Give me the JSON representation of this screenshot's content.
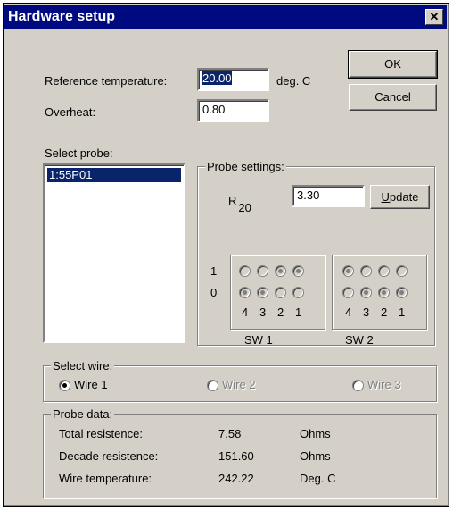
{
  "window": {
    "title": "Hardware setup",
    "close_glyph": "✕"
  },
  "reference": {
    "label": "Reference temperature:",
    "value": "20.00",
    "unit": "deg. C"
  },
  "overheat": {
    "label": "Overheat:",
    "value": "0.80"
  },
  "buttons": {
    "ok": "OK",
    "cancel": "Cancel",
    "update": "Update"
  },
  "probe": {
    "label": "Select probe:",
    "items": [
      "1:55P01"
    ],
    "selected": "1:55P01"
  },
  "settings": {
    "title": "Probe settings:",
    "r_label": "R",
    "r_sub": "20",
    "r_value": "3.30",
    "row_one": "1",
    "row_zero": "0",
    "sw1": {
      "label": "SW 1",
      "cols": [
        "4",
        "3",
        "2",
        "1"
      ],
      "row1": [
        false,
        false,
        true,
        true
      ],
      "row0": [
        true,
        true,
        false,
        false
      ]
    },
    "sw2": {
      "label": "SW 2",
      "cols": [
        "4",
        "3",
        "2",
        "1"
      ],
      "row1": [
        true,
        false,
        false,
        false
      ],
      "row0": [
        false,
        true,
        true,
        true
      ]
    }
  },
  "wire": {
    "title": "Select wire:",
    "options": [
      {
        "label": "Wire 1",
        "selected": true,
        "enabled": true
      },
      {
        "label": "Wire 2",
        "selected": false,
        "enabled": false
      },
      {
        "label": "Wire 3",
        "selected": false,
        "enabled": false
      }
    ]
  },
  "probe_data": {
    "title": "Probe data:",
    "rows": [
      {
        "label": "Total resistence:",
        "value": "7.58",
        "unit": "Ohms"
      },
      {
        "label": "Decade resistence:",
        "value": "151.60",
        "unit": "Ohms"
      },
      {
        "label": "Wire temperature:",
        "value": "242.22",
        "unit": "Deg. C"
      }
    ]
  }
}
